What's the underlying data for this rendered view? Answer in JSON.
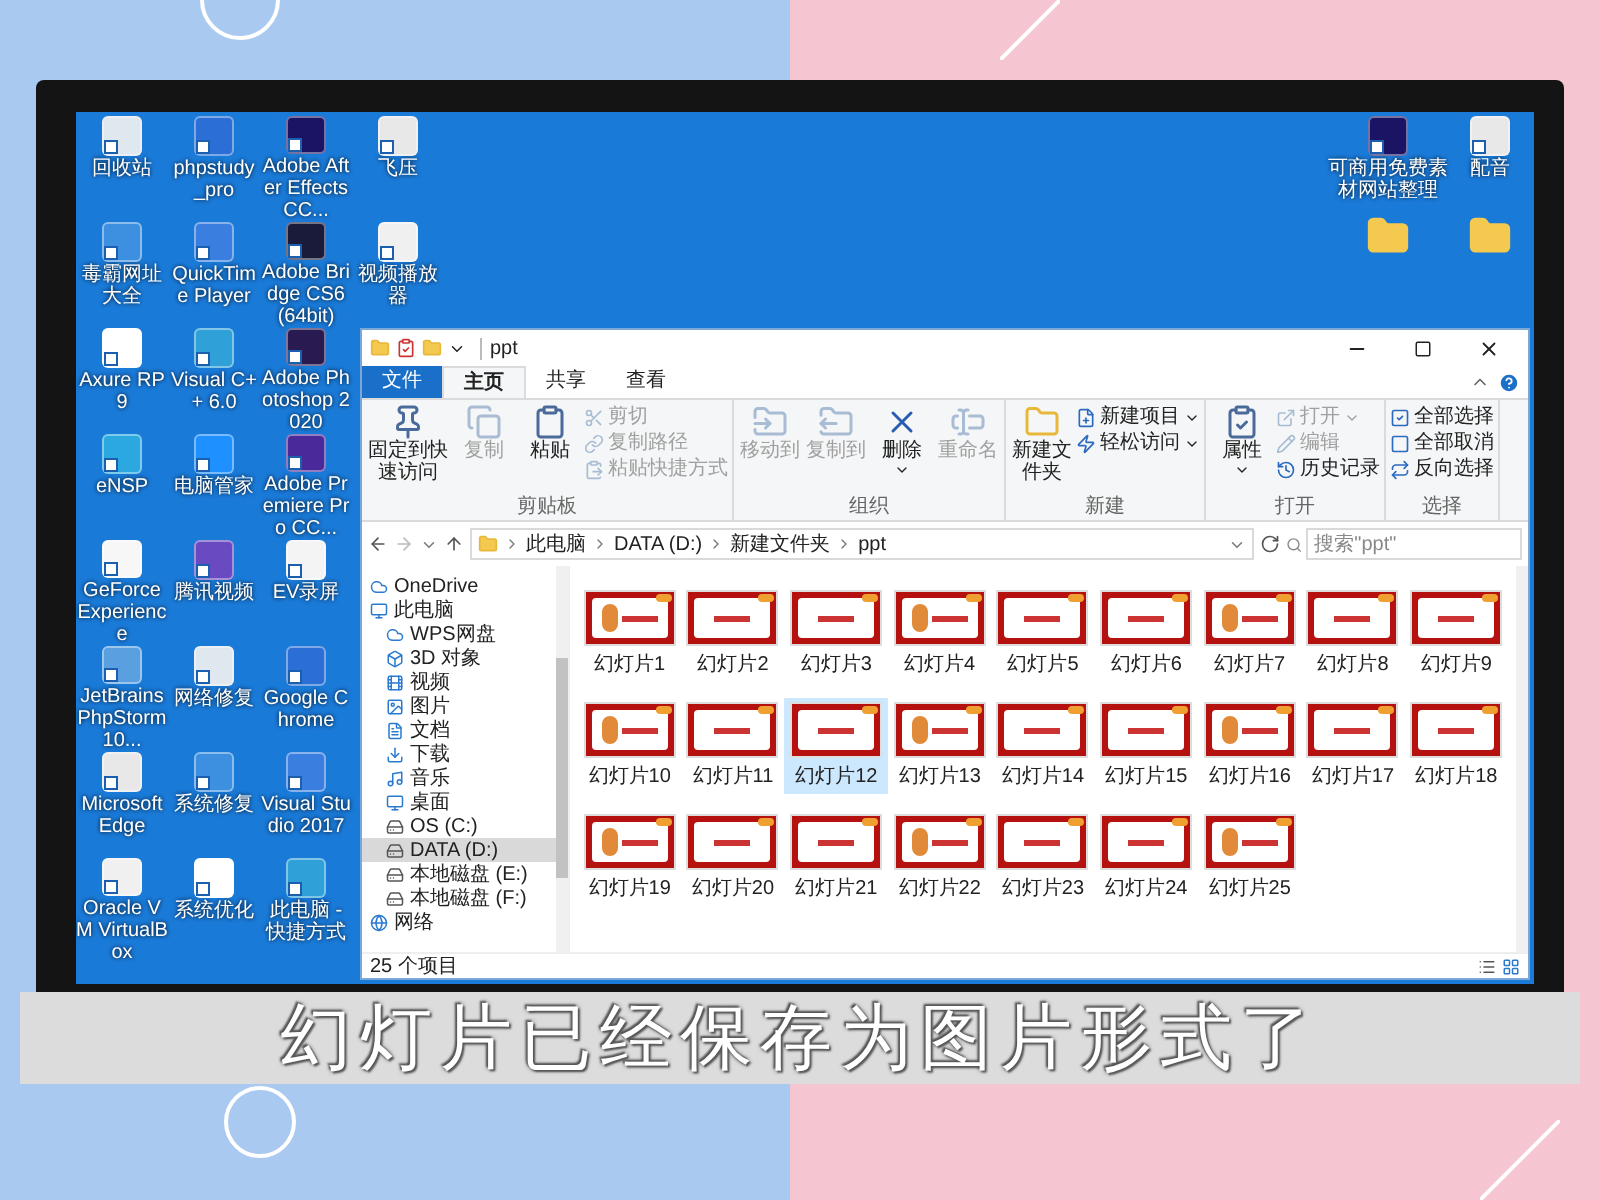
{
  "desktop": {
    "icon_rows": [
      [
        {
          "label": "回收站"
        },
        {
          "label": "phpstudy_pro"
        },
        {
          "label": "Adobe After Effects CC..."
        },
        {
          "label": "飞压"
        }
      ],
      [
        {
          "label": "毒霸网址大全"
        },
        {
          "label": "QuickTime Player"
        },
        {
          "label": "Adobe Bridge CS6 (64bit)"
        },
        {
          "label": "视频播放器"
        }
      ],
      [
        {
          "label": "Axure RP 9"
        },
        {
          "label": "Visual C++ 6.0"
        },
        {
          "label": "Adobe Photoshop 2020"
        }
      ],
      [
        {
          "label": "eNSP"
        },
        {
          "label": "电脑管家"
        },
        {
          "label": "Adobe Premiere Pro CC..."
        }
      ],
      [
        {
          "label": "GeForce Experience"
        },
        {
          "label": "腾讯视频"
        },
        {
          "label": "EV录屏"
        }
      ],
      [
        {
          "label": "JetBrains PhpStorm 10..."
        },
        {
          "label": "网络修复"
        },
        {
          "label": "Google Chrome"
        }
      ],
      [
        {
          "label": "Microsoft Edge"
        },
        {
          "label": "系统修复"
        },
        {
          "label": "Visual Studio 2017"
        }
      ],
      [
        {
          "label": "Oracle VM VirtualBox"
        },
        {
          "label": "系统优化"
        },
        {
          "label": "此电脑 - 快捷方式"
        }
      ]
    ],
    "right_icons": [
      {
        "label": "可商用免费素材网站整理"
      },
      {
        "label": "配音"
      }
    ]
  },
  "explorer": {
    "title": "ppt",
    "tabs": [
      {
        "label": "文件",
        "kind": "menu",
        "selected": false
      },
      {
        "label": "主页",
        "kind": "tab",
        "selected": true
      },
      {
        "label": "共享",
        "kind": "tab",
        "selected": false
      },
      {
        "label": "查看",
        "kind": "tab",
        "selected": false
      }
    ],
    "ribbon": [
      {
        "label": "剪贴板",
        "large": [
          {
            "label": "固定到快速访问",
            "disabled": false,
            "menu": false
          },
          {
            "label": "复制",
            "disabled": true,
            "menu": false
          },
          {
            "label": "粘贴",
            "disabled": false,
            "menu": false
          }
        ],
        "small": [
          {
            "label": "剪切",
            "disabled": true,
            "menu": false
          },
          {
            "label": "复制路径",
            "disabled": true,
            "menu": false
          },
          {
            "label": "粘贴快捷方式",
            "disabled": true,
            "menu": false
          }
        ]
      },
      {
        "label": "组织",
        "large": [
          {
            "label": "移动到",
            "disabled": true,
            "menu": false
          },
          {
            "label": "复制到",
            "disabled": true,
            "menu": false
          },
          {
            "label": "删除",
            "disabled": false,
            "menu": true
          },
          {
            "label": "重命名",
            "disabled": true,
            "menu": false
          }
        ]
      },
      {
        "label": "新建",
        "large": [
          {
            "label": "新建文件夹",
            "disabled": false,
            "menu": false
          }
        ],
        "small": [
          {
            "label": "新建项目",
            "disabled": false,
            "menu": true
          },
          {
            "label": "轻松访问",
            "disabled": false,
            "menu": true
          }
        ]
      },
      {
        "label": "打开",
        "large": [
          {
            "label": "属性",
            "disabled": false,
            "menu": true
          }
        ],
        "small": [
          {
            "label": "打开",
            "disabled": true,
            "menu": true
          },
          {
            "label": "编辑",
            "disabled": true,
            "menu": false
          },
          {
            "label": "历史记录",
            "disabled": false,
            "menu": false
          }
        ]
      },
      {
        "label": "选择",
        "small": [
          {
            "label": "全部选择",
            "disabled": false,
            "menu": false
          },
          {
            "label": "全部取消",
            "disabled": false,
            "menu": false
          },
          {
            "label": "反向选择",
            "disabled": false,
            "menu": false
          }
        ]
      }
    ],
    "path": [
      "此电脑",
      "DATA (D:)",
      "新建文件夹",
      "ppt"
    ],
    "search": {
      "placeholder": "搜索\"ppt\""
    },
    "nav": [
      {
        "label": "OneDrive",
        "selected": false
      },
      {
        "label": "此电脑",
        "selected": false,
        "children": [
          {
            "label": "WPS网盘",
            "selected": false
          },
          {
            "label": "3D 对象",
            "selected": false
          },
          {
            "label": "视频",
            "selected": false
          },
          {
            "label": "图片",
            "selected": false
          },
          {
            "label": "文档",
            "selected": false
          },
          {
            "label": "下载",
            "selected": false
          },
          {
            "label": "音乐",
            "selected": false
          },
          {
            "label": "桌面",
            "selected": false
          },
          {
            "label": "OS (C:)",
            "selected": false
          },
          {
            "label": "DATA (D:)",
            "selected": true
          },
          {
            "label": "本地磁盘 (E:)",
            "selected": false
          },
          {
            "label": "本地磁盘 (F:)",
            "selected": false
          }
        ]
      },
      {
        "label": "网络",
        "selected": false
      }
    ],
    "files": [
      {
        "label": "幻灯片1",
        "selected": false
      },
      {
        "label": "幻灯片2",
        "selected": false
      },
      {
        "label": "幻灯片3",
        "selected": false
      },
      {
        "label": "幻灯片4",
        "selected": false
      },
      {
        "label": "幻灯片5",
        "selected": false
      },
      {
        "label": "幻灯片6",
        "selected": false
      },
      {
        "label": "幻灯片7",
        "selected": false
      },
      {
        "label": "幻灯片8",
        "selected": false
      },
      {
        "label": "幻灯片9",
        "selected": false
      },
      {
        "label": "幻灯片10",
        "selected": false
      },
      {
        "label": "幻灯片11",
        "selected": false
      },
      {
        "label": "幻灯片12",
        "selected": true
      },
      {
        "label": "幻灯片13",
        "selected": false
      },
      {
        "label": "幻灯片14",
        "selected": false
      },
      {
        "label": "幻灯片15",
        "selected": false
      },
      {
        "label": "幻灯片16",
        "selected": false
      },
      {
        "label": "幻灯片17",
        "selected": false
      },
      {
        "label": "幻灯片18",
        "selected": false
      },
      {
        "label": "幻灯片19",
        "selected": false
      },
      {
        "label": "幻灯片20",
        "selected": false
      },
      {
        "label": "幻灯片21",
        "selected": false
      },
      {
        "label": "幻灯片22",
        "selected": false
      },
      {
        "label": "幻灯片23",
        "selected": false
      },
      {
        "label": "幻灯片24",
        "selected": false
      },
      {
        "label": "幻灯片25",
        "selected": false
      }
    ],
    "status": "25 个项目"
  },
  "caption": "幻灯片已经保存为图片形式了"
}
